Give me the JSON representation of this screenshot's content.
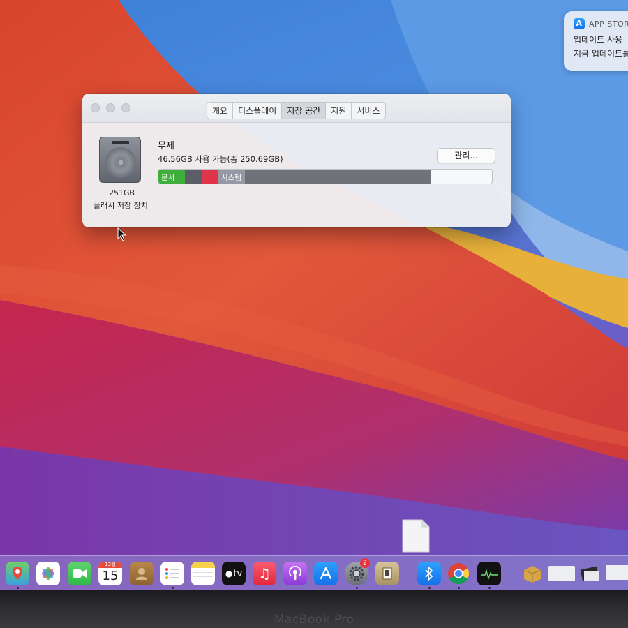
{
  "notification": {
    "app_name": "APP STOR",
    "line1": "업데이트 사용 ",
    "line2": "지금 업데이트를"
  },
  "window": {
    "tabs": [
      {
        "label": "개요",
        "active": false
      },
      {
        "label": "디스플레이",
        "active": false
      },
      {
        "label": "저장 공간",
        "active": true
      },
      {
        "label": "지원",
        "active": false
      },
      {
        "label": "서비스",
        "active": false
      }
    ],
    "disk": {
      "size": "251GB",
      "type": "플래시 저장 장치"
    },
    "volume": {
      "name": "무제",
      "availability": "46.56GB 사용 가능(총 250.69GB)"
    },
    "manage_button": "관리...",
    "storage_segments": [
      {
        "label": "문서",
        "fraction": 0.08,
        "color": "#3fae3c"
      },
      {
        "label": "",
        "fraction": 0.05,
        "color": "#5b5e66"
      },
      {
        "label": "",
        "fraction": 0.05,
        "color": "#e0344a"
      },
      {
        "label": "시스템",
        "fraction": 0.08,
        "color": "#9699a3"
      },
      {
        "label": "",
        "fraction": 0.555,
        "color": "#6f7279"
      }
    ]
  },
  "dock": {
    "calendar_month": "12월",
    "calendar_day": "15",
    "tv_label": "tv",
    "system_prefs_badge": "2"
  },
  "bezel_label": "MacBook Pro"
}
